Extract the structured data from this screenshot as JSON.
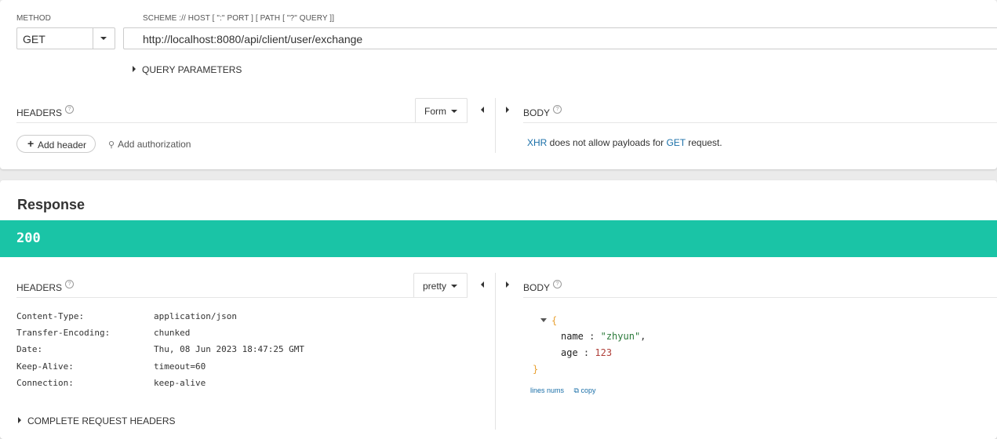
{
  "request": {
    "method_label": "METHOD",
    "method_value": "GET",
    "url_label": "SCHEME :// HOST [ \":\" PORT ] [ PATH [ \"?\" QUERY ]]",
    "url_value": "http://localhost:8080/api/client/user/exchange",
    "query_parameters_label": "QUERY PARAMETERS",
    "headers_title": "HEADERS",
    "headers_format": "Form",
    "body_title": "BODY",
    "add_header_label": "Add header",
    "add_authorization_label": "Add authorization",
    "body_message": {
      "part1": "XHR",
      "part2": " does not allow payloads for ",
      "part3": "GET",
      "part4": " request."
    }
  },
  "response": {
    "title": "Response",
    "status_code": "200",
    "status_color": "#1ac4a6",
    "headers_title": "HEADERS",
    "headers_format": "pretty",
    "body_title": "BODY",
    "headers": [
      {
        "key": "Content-Type:",
        "value": "application/json"
      },
      {
        "key": "Transfer-Encoding:",
        "value": "chunked"
      },
      {
        "key": "Date:",
        "value": "Thu, 08 Jun 2023 18:47:25 GMT"
      },
      {
        "key": "Keep-Alive:",
        "value": "timeout=60"
      },
      {
        "key": "Connection:",
        "value": "keep-alive"
      }
    ],
    "complete_request_headers_label": "COMPLETE REQUEST HEADERS",
    "body_json": {
      "open_brace": "{",
      "close_brace": "}",
      "fields": [
        {
          "key": "name",
          "value": "\"zhyun\"",
          "suffix": ",",
          "kind": "string"
        },
        {
          "key": "age",
          "value": "123",
          "suffix": "",
          "kind": "number"
        }
      ]
    },
    "lines_nums_label": "lines nums",
    "copy_label": "copy"
  },
  "icons": [
    "help-icon",
    "caret-down-icon",
    "arrow-left-icon",
    "arrow-right-icon",
    "plus-icon",
    "key-icon",
    "copy-icon",
    "chevron-right-icon",
    "chevron-down-icon"
  ]
}
